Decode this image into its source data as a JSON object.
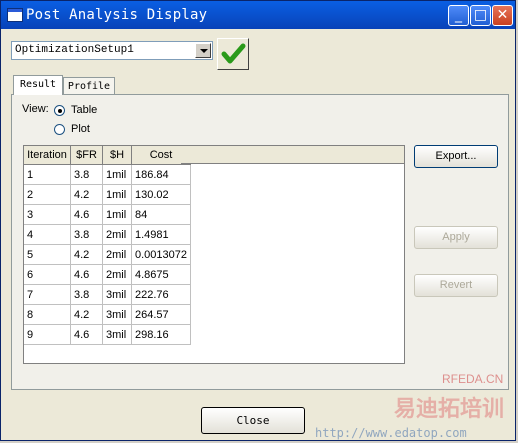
{
  "window": {
    "title": "Post Analysis Display"
  },
  "titlebar_buttons": {
    "minimize": "_",
    "maximize": "□",
    "close": "✕"
  },
  "setup_select": {
    "value": "OptimizationSetup1"
  },
  "tabs": [
    {
      "label": "Result",
      "selected": true
    },
    {
      "label": "Profile",
      "selected": false
    }
  ],
  "view": {
    "label": "View:",
    "options": [
      {
        "label": "Table",
        "selected": true
      },
      {
        "label": "Plot",
        "selected": false
      }
    ]
  },
  "table": {
    "columns": [
      "Iteration",
      "$FR",
      "$H",
      "Cost"
    ],
    "rows": [
      [
        "1",
        "3.8",
        "1mil",
        "186.84"
      ],
      [
        "2",
        "4.2",
        "1mil",
        "130.02"
      ],
      [
        "3",
        "4.6",
        "1mil",
        "84"
      ],
      [
        "4",
        "3.8",
        "2mil",
        "1.4981"
      ],
      [
        "5",
        "4.2",
        "2mil",
        "0.0013072"
      ],
      [
        "6",
        "4.6",
        "2mil",
        "4.8675"
      ],
      [
        "7",
        "3.8",
        "3mil",
        "222.76"
      ],
      [
        "8",
        "4.2",
        "3mil",
        "264.57"
      ],
      [
        "9",
        "4.6",
        "3mil",
        "298.16"
      ]
    ]
  },
  "buttons": {
    "export": "Export...",
    "apply": "Apply",
    "revert": "Revert",
    "close": "Close"
  },
  "watermark": {
    "rfeda": "RFEDA.CN",
    "chinese": "易迪拓培训",
    "url": "http://www.edatop.com"
  },
  "colors": {
    "titlebar": "#0a5fe3",
    "check": "#2a9a1a"
  }
}
